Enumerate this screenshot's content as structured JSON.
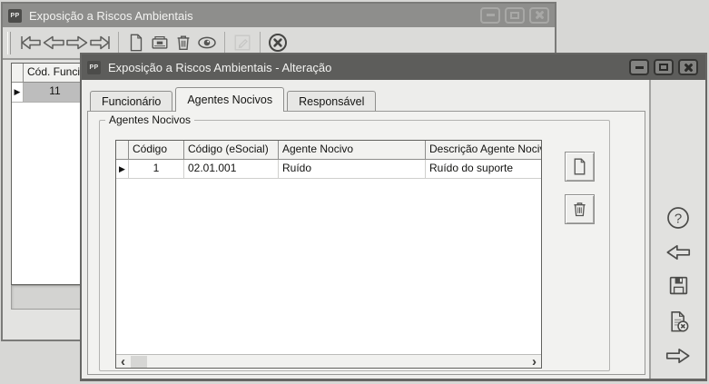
{
  "app_icon_label": "PP",
  "glyphs": {
    "row_selector": "▶",
    "scroll_left": "‹",
    "scroll_right": "›"
  },
  "colors": {
    "titlebar_active": "#5d5d5b",
    "titlebar_inactive": "#8e8e8c",
    "selected_row_bg": "#bdbdbd",
    "tab_page_bg": "#f2f2f0"
  },
  "background_window": {
    "title": "Exposição a Riscos Ambientais",
    "toolbar_icons": [
      "first-record",
      "prior-record",
      "next-record",
      "last-record",
      "new-record",
      "open-record",
      "delete-record",
      "view-record",
      "edit-record-disabled",
      "cancel"
    ],
    "table": {
      "columns": [
        "Cód. Funcion"
      ],
      "rows": [
        [
          "11"
        ]
      ]
    }
  },
  "dialog": {
    "title": "Exposição a Riscos Ambientais - Alteração",
    "tabs": [
      {
        "label": "Funcionário"
      },
      {
        "label": "Agentes Nocivos"
      },
      {
        "label": "Responsável"
      }
    ],
    "active_tab": "Agentes Nocivos",
    "group_label": "Agentes Nocivos",
    "table": {
      "columns": [
        "Código",
        "Código (eSocial)",
        "Agente Nocivo",
        "Descrição Agente Nocivo"
      ],
      "rows": [
        {
          "codigo": "1",
          "codigo_esocial": "02.01.001",
          "agente_nocivo": "Ruído",
          "descricao": "Ruído do suporte"
        }
      ]
    },
    "group_buttons": [
      "new-item",
      "delete-item"
    ],
    "rail_icons": [
      "help",
      "previous",
      "save",
      "cancel-record",
      "next"
    ]
  }
}
